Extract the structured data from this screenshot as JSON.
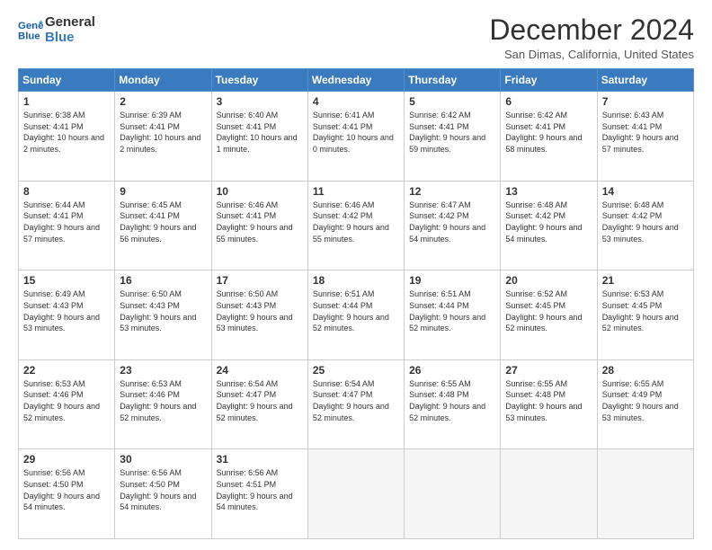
{
  "logo": {
    "line1": "General",
    "line2": "Blue"
  },
  "title": "December 2024",
  "subtitle": "San Dimas, California, United States",
  "days_of_week": [
    "Sunday",
    "Monday",
    "Tuesday",
    "Wednesday",
    "Thursday",
    "Friday",
    "Saturday"
  ],
  "weeks": [
    [
      {
        "day": "1",
        "sunrise": "6:38 AM",
        "sunset": "4:41 PM",
        "daylight": "10 hours and 2 minutes."
      },
      {
        "day": "2",
        "sunrise": "6:39 AM",
        "sunset": "4:41 PM",
        "daylight": "10 hours and 2 minutes."
      },
      {
        "day": "3",
        "sunrise": "6:40 AM",
        "sunset": "4:41 PM",
        "daylight": "10 hours and 1 minute."
      },
      {
        "day": "4",
        "sunrise": "6:41 AM",
        "sunset": "4:41 PM",
        "daylight": "10 hours and 0 minutes."
      },
      {
        "day": "5",
        "sunrise": "6:42 AM",
        "sunset": "4:41 PM",
        "daylight": "9 hours and 59 minutes."
      },
      {
        "day": "6",
        "sunrise": "6:42 AM",
        "sunset": "4:41 PM",
        "daylight": "9 hours and 58 minutes."
      },
      {
        "day": "7",
        "sunrise": "6:43 AM",
        "sunset": "4:41 PM",
        "daylight": "9 hours and 57 minutes."
      }
    ],
    [
      {
        "day": "8",
        "sunrise": "6:44 AM",
        "sunset": "4:41 PM",
        "daylight": "9 hours and 57 minutes."
      },
      {
        "day": "9",
        "sunrise": "6:45 AM",
        "sunset": "4:41 PM",
        "daylight": "9 hours and 56 minutes."
      },
      {
        "day": "10",
        "sunrise": "6:46 AM",
        "sunset": "4:41 PM",
        "daylight": "9 hours and 55 minutes."
      },
      {
        "day": "11",
        "sunrise": "6:46 AM",
        "sunset": "4:42 PM",
        "daylight": "9 hours and 55 minutes."
      },
      {
        "day": "12",
        "sunrise": "6:47 AM",
        "sunset": "4:42 PM",
        "daylight": "9 hours and 54 minutes."
      },
      {
        "day": "13",
        "sunrise": "6:48 AM",
        "sunset": "4:42 PM",
        "daylight": "9 hours and 54 minutes."
      },
      {
        "day": "14",
        "sunrise": "6:48 AM",
        "sunset": "4:42 PM",
        "daylight": "9 hours and 53 minutes."
      }
    ],
    [
      {
        "day": "15",
        "sunrise": "6:49 AM",
        "sunset": "4:43 PM",
        "daylight": "9 hours and 53 minutes."
      },
      {
        "day": "16",
        "sunrise": "6:50 AM",
        "sunset": "4:43 PM",
        "daylight": "9 hours and 53 minutes."
      },
      {
        "day": "17",
        "sunrise": "6:50 AM",
        "sunset": "4:43 PM",
        "daylight": "9 hours and 53 minutes."
      },
      {
        "day": "18",
        "sunrise": "6:51 AM",
        "sunset": "4:44 PM",
        "daylight": "9 hours and 52 minutes."
      },
      {
        "day": "19",
        "sunrise": "6:51 AM",
        "sunset": "4:44 PM",
        "daylight": "9 hours and 52 minutes."
      },
      {
        "day": "20",
        "sunrise": "6:52 AM",
        "sunset": "4:45 PM",
        "daylight": "9 hours and 52 minutes."
      },
      {
        "day": "21",
        "sunrise": "6:53 AM",
        "sunset": "4:45 PM",
        "daylight": "9 hours and 52 minutes."
      }
    ],
    [
      {
        "day": "22",
        "sunrise": "6:53 AM",
        "sunset": "4:46 PM",
        "daylight": "9 hours and 52 minutes."
      },
      {
        "day": "23",
        "sunrise": "6:53 AM",
        "sunset": "4:46 PM",
        "daylight": "9 hours and 52 minutes."
      },
      {
        "day": "24",
        "sunrise": "6:54 AM",
        "sunset": "4:47 PM",
        "daylight": "9 hours and 52 minutes."
      },
      {
        "day": "25",
        "sunrise": "6:54 AM",
        "sunset": "4:47 PM",
        "daylight": "9 hours and 52 minutes."
      },
      {
        "day": "26",
        "sunrise": "6:55 AM",
        "sunset": "4:48 PM",
        "daylight": "9 hours and 52 minutes."
      },
      {
        "day": "27",
        "sunrise": "6:55 AM",
        "sunset": "4:48 PM",
        "daylight": "9 hours and 53 minutes."
      },
      {
        "day": "28",
        "sunrise": "6:55 AM",
        "sunset": "4:49 PM",
        "daylight": "9 hours and 53 minutes."
      }
    ],
    [
      {
        "day": "29",
        "sunrise": "6:56 AM",
        "sunset": "4:50 PM",
        "daylight": "9 hours and 54 minutes."
      },
      {
        "day": "30",
        "sunrise": "6:56 AM",
        "sunset": "4:50 PM",
        "daylight": "9 hours and 54 minutes."
      },
      {
        "day": "31",
        "sunrise": "6:56 AM",
        "sunset": "4:51 PM",
        "daylight": "9 hours and 54 minutes."
      },
      null,
      null,
      null,
      null
    ]
  ]
}
